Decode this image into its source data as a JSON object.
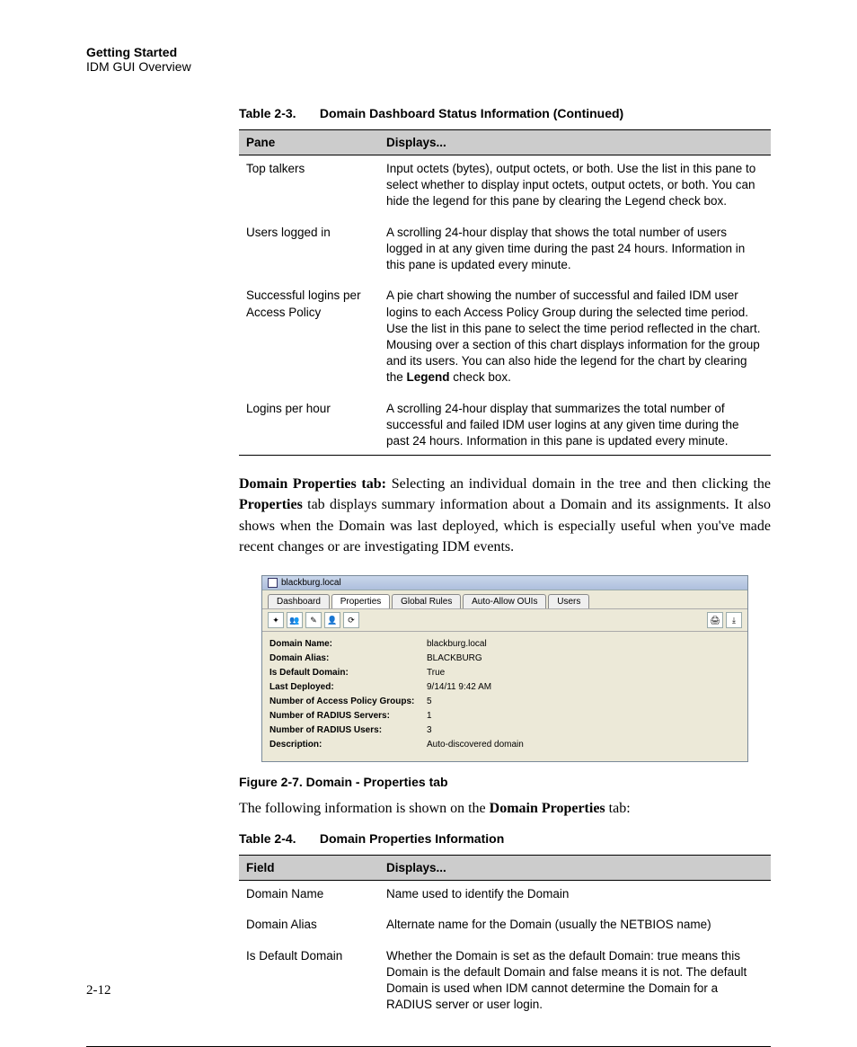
{
  "header": {
    "title": "Getting Started",
    "subtitle": "IDM GUI Overview"
  },
  "table23": {
    "caption_num": "Table 2-3.",
    "caption_text": "Domain Dashboard Status Information (Continued)",
    "col1": "Pane",
    "col2": "Displays...",
    "rows": [
      {
        "pane": "Top talkers",
        "disp": "Input octets (bytes), output octets, or both. Use the list in this pane to select whether to display input octets, output octets, or both. You can hide the legend for this pane by clearing the Legend check box."
      },
      {
        "pane": "Users logged in",
        "disp": "A scrolling 24-hour display that shows the total number of users logged in at any given time during the past 24 hours. Information in this pane is updated every minute."
      },
      {
        "pane": "Successful logins per Access Policy",
        "disp_pre": "A pie chart showing the number of successful and failed IDM user logins to each Access Policy Group during the selected time period. Use the list in this pane to select the time period reflected in the chart. Mousing over a section of this chart displays information for the group and its users. You can also hide the legend for the chart by clearing the ",
        "disp_bold": "Legend",
        "disp_post": " check box."
      },
      {
        "pane": "Logins per hour",
        "disp": "A scrolling 24-hour display that summarizes the total number of successful and failed IDM user logins at any given time during the past 24 hours. Information in this pane is updated every minute."
      }
    ]
  },
  "para_dp": {
    "lead_bold": "Domain Properties tab:",
    "pre": " Selecting an individual domain in the tree and then clicking the ",
    "b2": "Properties",
    "rest": " tab displays summary information about a Domain and its assignments. It also shows when the Domain was last deployed, which is especially useful when you've made recent changes or are investigating IDM events."
  },
  "win": {
    "title": "blackburg.local",
    "tabs": [
      "Dashboard",
      "Properties",
      "Global Rules",
      "Auto-Allow OUIs",
      "Users"
    ],
    "rows": [
      {
        "lbl": "Domain Name:",
        "val": "blackburg.local"
      },
      {
        "lbl": "Domain Alias:",
        "val": "BLACKBURG"
      },
      {
        "lbl": "Is Default Domain:",
        "val": "True"
      },
      {
        "lbl": "Last Deployed:",
        "val": "9/14/11 9:42 AM"
      },
      {
        "lbl": "Number of Access Policy Groups:",
        "val": "5"
      },
      {
        "lbl": "Number of RADIUS Servers:",
        "val": "1"
      },
      {
        "lbl": "Number of RADIUS Users:",
        "val": "3"
      },
      {
        "lbl": "Description:",
        "val": "Auto-discovered domain"
      }
    ]
  },
  "fig_caption": "Figure 2-7. Domain - Properties tab",
  "para_follow": {
    "pre": "The following information is shown on the ",
    "b": "Domain Properties",
    "post": " tab:"
  },
  "table24": {
    "caption_num": "Table 2-4.",
    "caption_text": "Domain Properties Information",
    "col1": "Field",
    "col2": "Displays...",
    "rows": [
      {
        "f": "Domain Name",
        "d": "Name used to identify the Domain"
      },
      {
        "f": "Domain Alias",
        "d": "Alternate name for the Domain (usually the NETBIOS name)"
      },
      {
        "f": "Is Default Domain",
        "d": "Whether the Domain is set as the default Domain: true means this Domain is the default Domain and false means it is not. The default Domain is used when IDM cannot determine the Domain for a RADIUS server or user login."
      }
    ]
  },
  "page_number": "2-12"
}
